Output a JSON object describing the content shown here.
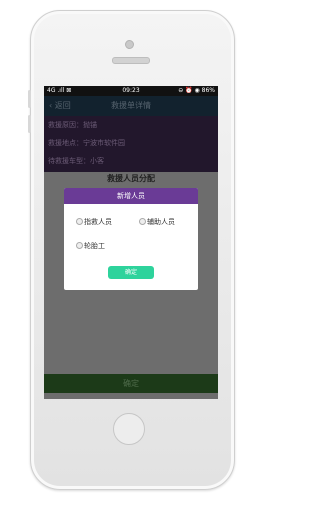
{
  "status_bar": {
    "network": "4G .ıll ⊠",
    "time": "09:23",
    "indicators": "⊖ ⏰ ◉ 86%"
  },
  "nav": {
    "back_label": "返回",
    "title": "救援单详情"
  },
  "info": [
    {
      "text": "救援原因：抛锚"
    },
    {
      "text": "救援地点：宁波市软件园"
    },
    {
      "text": "待救援车型：小客"
    }
  ],
  "section_title": "救援人员分配",
  "modal": {
    "title": "新增人员",
    "options": [
      "指救人员",
      "辅助人员",
      "轮胎工"
    ],
    "confirm_label": "确定"
  },
  "bottom_button": "确定",
  "colors": {
    "modal_header": "#6a3b96",
    "confirm": "#2ed39c",
    "bottom_bar": "#1c3a18"
  }
}
